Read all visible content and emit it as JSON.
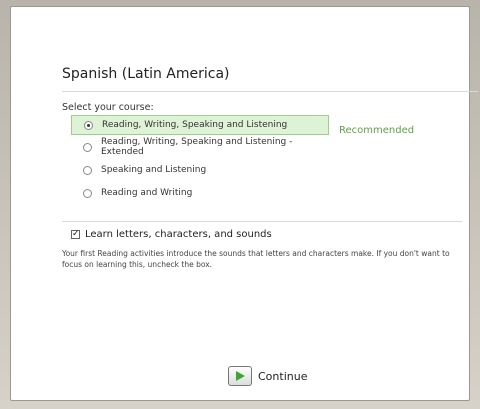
{
  "title": "Spanish (Latin America)",
  "select_label": "Select your course:",
  "options": [
    {
      "label": "Reading, Writing, Speaking and Listening",
      "selected": true
    },
    {
      "label": "Reading, Writing, Speaking and Listening - Extended",
      "selected": false
    },
    {
      "label": "Speaking and Listening",
      "selected": false
    },
    {
      "label": "Reading and Writing",
      "selected": false
    }
  ],
  "recommended": "Recommended",
  "learn_checkbox": {
    "label": "Learn letters, characters, and sounds",
    "checked": true
  },
  "description": "Your first Reading activities introduce the sounds that letters and characters make. If you don't want to focus on learning this, uncheck the box.",
  "continue_label": "Continue",
  "colors": {
    "accent_green": "#5fa04a",
    "selected_bg": "#def2d6",
    "play_arrow": "#3da534"
  },
  "icons": {
    "continue": "play-icon"
  }
}
